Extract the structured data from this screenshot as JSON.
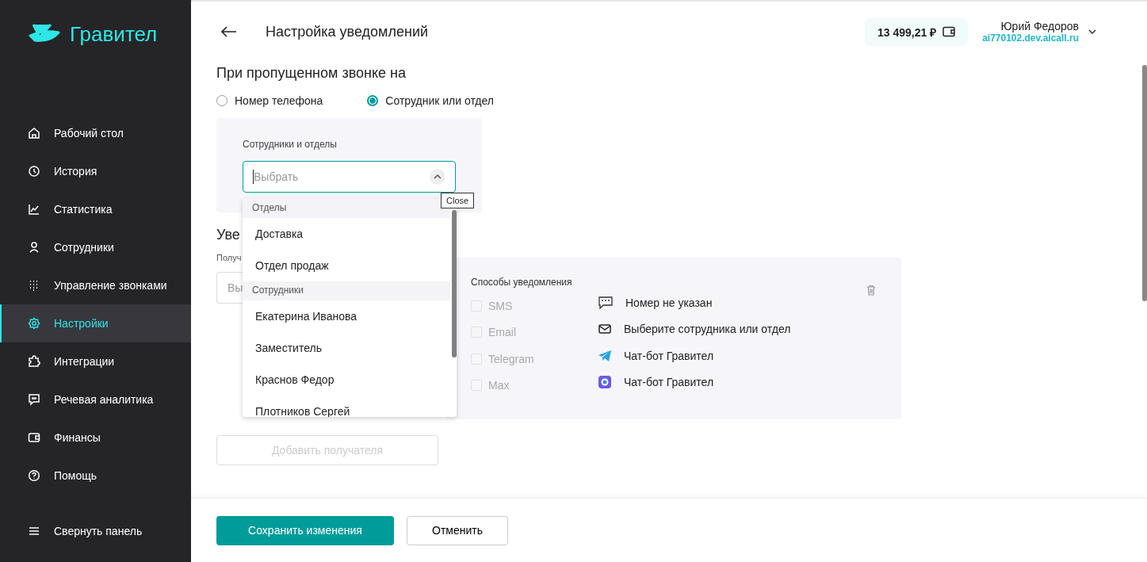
{
  "brand": {
    "name": "Гравител"
  },
  "sidebar": {
    "items": [
      {
        "label": "Рабочий стол",
        "selected": false
      },
      {
        "label": "История",
        "selected": false
      },
      {
        "label": "Статистика",
        "selected": false
      },
      {
        "label": "Сотрудники",
        "selected": false
      },
      {
        "label": "Управление звонками",
        "selected": false
      },
      {
        "label": "Настройки",
        "selected": true
      },
      {
        "label": "Интеграции",
        "selected": false
      },
      {
        "label": "Речевая аналитика",
        "selected": false
      },
      {
        "label": "Финансы",
        "selected": false
      },
      {
        "label": "Помощь",
        "selected": false
      }
    ],
    "collapse": "Свернуть панель"
  },
  "header": {
    "title": "Настройка уведомлений",
    "balance": "13 499,21 ₽",
    "user": "Юрий Федоров",
    "domain": "ai770102.dev.aicall.ru"
  },
  "missed_call": {
    "heading": "При пропущенном звонке на",
    "options": [
      {
        "label": "Номер телефона",
        "selected": false
      },
      {
        "label": "Сотрудник или отдел",
        "selected": true
      }
    ],
    "select_label": "Сотрудники и отделы",
    "select_placeholder": "Выбрать",
    "tooltip": "Close",
    "dropdown": [
      {
        "group": "Отделы",
        "items": [
          "Доставка",
          "Отдел продаж"
        ]
      },
      {
        "group": "Сотрудники",
        "items": [
          "Екатерина Иванова",
          "Заместитель",
          "Краснов Федор",
          "Плотников Сергей"
        ]
      }
    ]
  },
  "recipients": {
    "heading": "Уве",
    "label": "Получ",
    "placeholder": "Вы",
    "card_title": "Способы уведомления",
    "methods": [
      {
        "label": "SMS",
        "checked": false,
        "disabled": true
      },
      {
        "label": "Email",
        "checked": false,
        "disabled": true
      },
      {
        "label": "Telegram",
        "checked": false,
        "disabled": true
      },
      {
        "label": "Max",
        "checked": false,
        "disabled": true
      }
    ],
    "channels": [
      {
        "kind": "sms",
        "text": "Номер не указан"
      },
      {
        "kind": "email",
        "text": "Выберите сотрудника или отдел"
      },
      {
        "kind": "telegram",
        "text": "Чат-бот Гравител"
      },
      {
        "kind": "max",
        "text": "Чат-бот Гравител"
      }
    ],
    "add_button": {
      "label": "Добавить получателя",
      "disabled": true
    }
  },
  "footer": {
    "save": "Сохранить изменения",
    "cancel": "Отменить"
  }
}
